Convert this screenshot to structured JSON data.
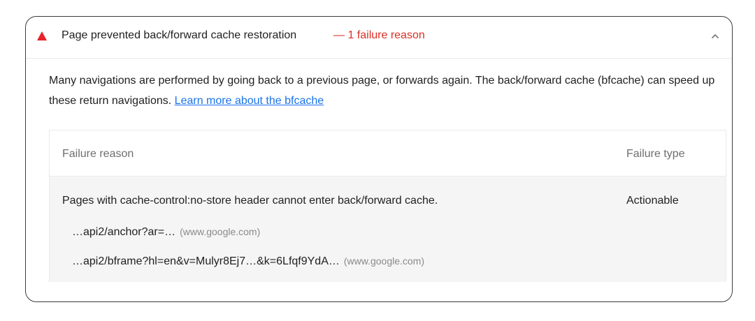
{
  "audit": {
    "title": "Page prevented back/forward cache restoration",
    "display_value": "— 1 failure reason",
    "status": "fail",
    "status_color": "#e8232a",
    "expanded": true,
    "chevron_icon": "chevron-up-icon"
  },
  "description": {
    "text": "Many navigations are performed by going back to a previous page, or forwards again. The back/forward cache (bfcache) can speed up these return navigations. ",
    "link_text": "Learn more about the bfcache",
    "link_color": "#1a73e8"
  },
  "table": {
    "headers": {
      "reason": "Failure reason",
      "type": "Failure type"
    },
    "rows": [
      {
        "reason": "Pages with cache-control:no-store header cannot enter back/forward cache.",
        "type": "Actionable",
        "subitems": [
          {
            "url": "…api2/anchor?ar=…",
            "origin": "(www.google.com)"
          },
          {
            "url": "…api2/bframe?hl=en&v=Mulyr8Ej7…&k=6Lfqf9YdA…",
            "origin": "(www.google.com)"
          }
        ]
      }
    ]
  }
}
